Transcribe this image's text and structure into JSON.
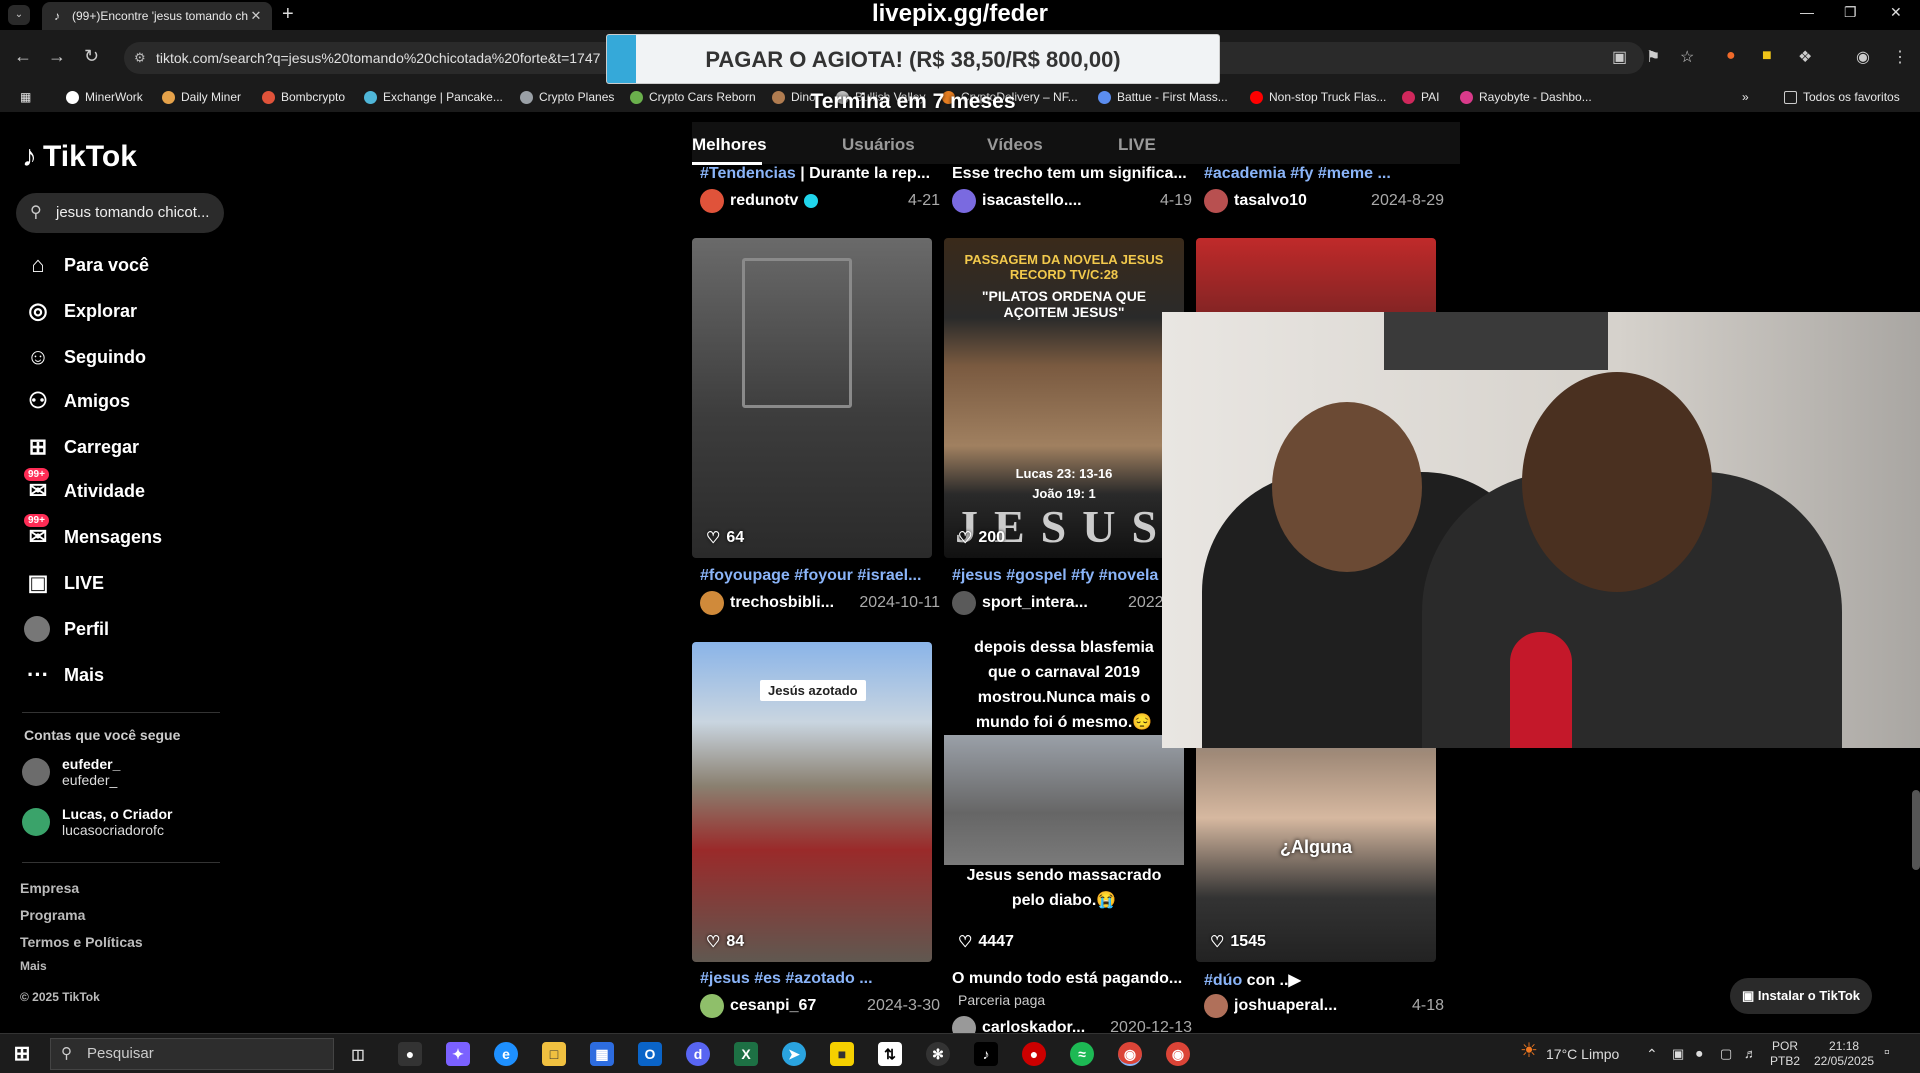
{
  "browser": {
    "tab_title": "(99+)Encontre 'jesus tomando ch",
    "url": "tiktok.com/search?q=jesus%20tomando%20chicotada%20forte&t=1747",
    "bookmarks": [
      {
        "label": "MinerWork",
        "color": "#ffffff"
      },
      {
        "label": "Daily Miner",
        "color": "#e5a24a"
      },
      {
        "label": "Bombcrypto",
        "color": "#e0533a"
      },
      {
        "label": "Exchange | Pancake...",
        "color": "#4fb6d8"
      },
      {
        "label": "Crypto Planes",
        "color": "#9aa0a6"
      },
      {
        "label": "Crypto Cars Reborn",
        "color": "#6ab04c"
      },
      {
        "label": "Dino",
        "color": "#b07c50"
      },
      {
        "label": "Bullish Valley",
        "color": "#c0c0c0"
      },
      {
        "label": "CryptoDelivery – NF...",
        "color": "#e67e22"
      },
      {
        "label": "Battue - First Mass...",
        "color": "#5b8def"
      },
      {
        "label": "Non-stop Truck Flas...",
        "color": "#ff0000"
      },
      {
        "label": "PAI",
        "color": "#d0285c"
      },
      {
        "label": "Rayobyte - Dashbo...",
        "color": "#d93a8a"
      }
    ],
    "all_bookmarks": "Todos os favoritos",
    "more": "»"
  },
  "overlay": {
    "url_text": "livepix.gg/feder",
    "donation_text": "PAGAR O AGIOTA! (R$ 38,50/R$ 800,00)",
    "donation_progress": 0.048,
    "subtitle": "Termina em 7 meses"
  },
  "tiktok": {
    "logo": "TikTok",
    "search_value": "jesus tomando chicot...",
    "nav": [
      {
        "label": "Para você",
        "icon": "⌂"
      },
      {
        "label": "Explorar",
        "icon": "◎"
      },
      {
        "label": "Seguindo",
        "icon": "☺"
      },
      {
        "label": "Amigos",
        "icon": "⚇"
      },
      {
        "label": "Carregar",
        "icon": "⊞"
      },
      {
        "label": "Atividade",
        "icon": "✉",
        "badge": "99+"
      },
      {
        "label": "Mensagens",
        "icon": "✉",
        "badge": "99+"
      },
      {
        "label": "LIVE",
        "icon": "▣"
      },
      {
        "label": "Perfil",
        "icon": ""
      },
      {
        "label": "Mais",
        "icon": "···"
      }
    ],
    "following_title": "Contas que você segue",
    "following": [
      {
        "name": "eufeder_",
        "handle": "eufeder_"
      },
      {
        "name": "Lucas, o Criador",
        "handle": "lucasocriadorofc"
      }
    ],
    "footer": [
      "Empresa",
      "Programa",
      "Termos e Políticas",
      "Mais",
      "© 2025 TikTok"
    ],
    "tabs": [
      "Melhores",
      "Usuários",
      "Vídeos",
      "LIVE"
    ],
    "top_row": [
      {
        "caption_tag": "#Tendencias",
        "caption_rest": " | Durante la rep...",
        "user": "redunotv",
        "date": "4-21",
        "verified": true
      },
      {
        "caption_tag": "",
        "caption_rest": "Esse trecho tem um significa...",
        "user": "isacastello....",
        "date": "4-19"
      },
      {
        "caption_tag": "#academia #fy #meme ...",
        "caption_rest": "",
        "user": "tasalvo10",
        "date": "2024-8-29"
      }
    ],
    "mid_row": [
      {
        "likes": "64",
        "caption_tag": "#foyoupage #foyour #israel...",
        "user": "trechosbibli...",
        "date": "2024-10-11"
      },
      {
        "likes": "200",
        "caption_tag": "#jesus #gospel #fy #novela",
        "user": "sport_intera...",
        "date": "2022-5-2",
        "thumb_top": "PASSAGEM DA NOVELA JESUS RECORD TV/C:28",
        "thumb_quote": "\"PILATOS ORDENA QUE AÇOITEM JESUS\"",
        "thumb_ref1": "Lucas 23: 13-16",
        "thumb_ref2": "João 19: 1",
        "thumb_big": "JESUS"
      }
    ],
    "bottom_row": [
      {
        "likes": "84",
        "caption_tag": "#jesus #es #azotado ...",
        "caption_rest": "",
        "user": "cesanpi_67",
        "date": "2024-3-30",
        "thumb_label": "Jesús azotado"
      },
      {
        "likes": "4447",
        "caption_rest": "O mundo todo está pagando...",
        "sponsored": "Parceria paga",
        "user": "carloskador...",
        "date": "2020-12-13",
        "thumb_top": "depois dessa blasfemia que o carnaval 2019 mostrou.Nunca mais o mundo foi ó mesmo.😔",
        "thumb_bottom": "Jesus sendo massacrado pelo diabo.😭"
      },
      {
        "likes": "1545",
        "caption_tag": "#dúo",
        "caption_rest": " con ..▶",
        "user": "joshuaperal...",
        "date": "4-18",
        "thumb_label": "¿Alguna"
      }
    ],
    "install": "Instalar o TikTok"
  },
  "taskbar": {
    "search_placeholder": "Pesquisar",
    "weather": "17°C  Limpo",
    "lang1": "POR",
    "lang2": "PTB2",
    "time": "21:18",
    "date": "22/05/2025"
  }
}
